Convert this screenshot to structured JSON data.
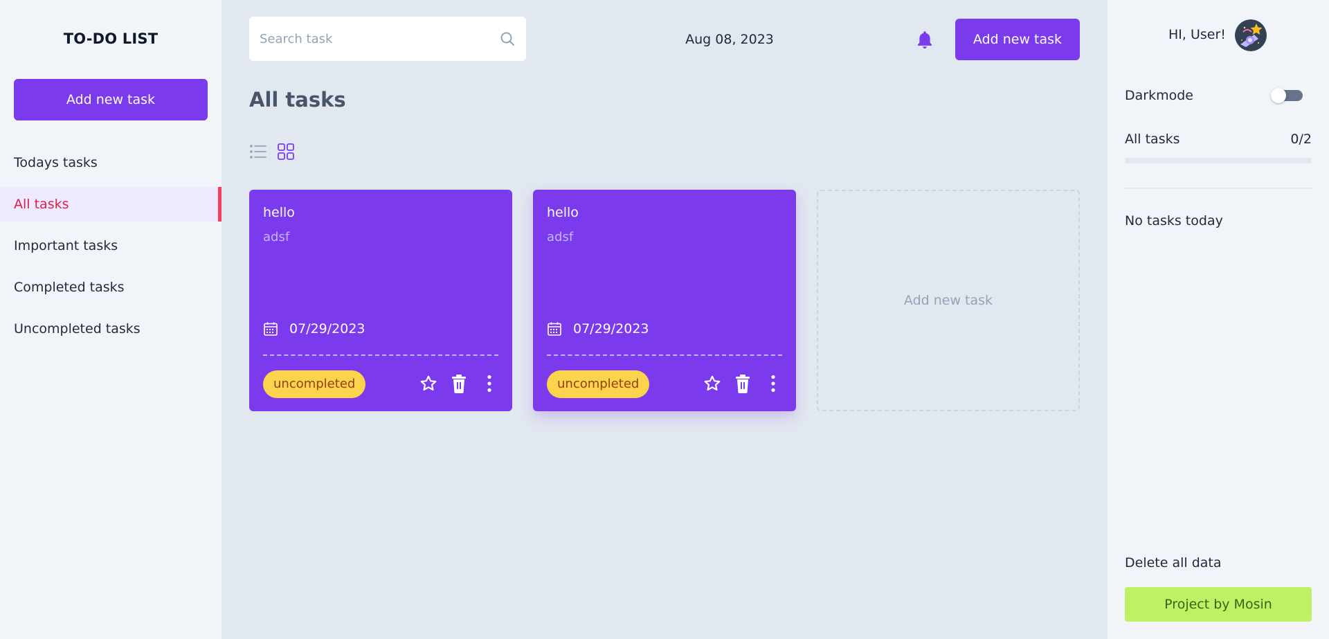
{
  "app": {
    "brand": "TO-DO LIST",
    "accent_color": "#7c3aed"
  },
  "sidebar": {
    "add_button": "Add new task",
    "items": [
      {
        "label": "Todays tasks",
        "active": false
      },
      {
        "label": "All tasks",
        "active": true
      },
      {
        "label": "Important tasks",
        "active": false
      },
      {
        "label": "Completed tasks",
        "active": false
      },
      {
        "label": "Uncompleted tasks",
        "active": false
      }
    ]
  },
  "header": {
    "search_placeholder": "Search task",
    "date": "Aug 08, 2023",
    "add_button": "Add new task",
    "icons": {
      "search": "search-icon",
      "notification": "bell-icon"
    }
  },
  "main": {
    "title": "All tasks",
    "view_modes": [
      "list",
      "grid"
    ],
    "active_view": "grid",
    "tasks": [
      {
        "title": "hello",
        "description": "adsf",
        "date": "07/29/2023",
        "status": "uncompleted"
      },
      {
        "title": "hello",
        "description": "adsf",
        "date": "07/29/2023",
        "status": "uncompleted"
      }
    ],
    "add_card_label": "Add new task"
  },
  "right_panel": {
    "greeting": "HI, User!",
    "darkmode_label": "Darkmode",
    "darkmode_enabled": false,
    "progress_label": "All tasks",
    "progress_count": "0/2",
    "progress_fraction": 0,
    "today_message": "No tasks today",
    "delete_all": "Delete all data",
    "credit_button": "Project by Mosin"
  }
}
